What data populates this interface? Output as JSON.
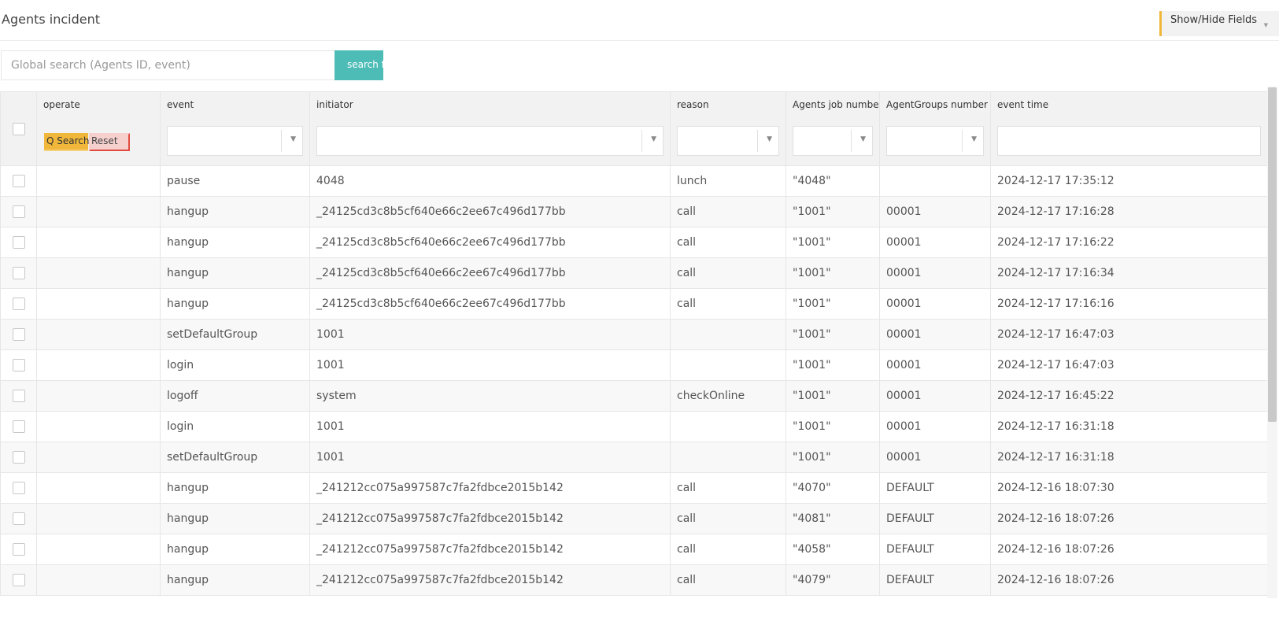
{
  "header": {
    "title": "Agents incident",
    "show_hide_label": "Show/Hide Fields"
  },
  "search": {
    "placeholder": "Global search (Agents ID, event)",
    "button_label": "search fo"
  },
  "table": {
    "columns": {
      "operate": "operate",
      "event": "event",
      "initiator": "initiator",
      "reason": "reason",
      "agent_job": "Agents job number",
      "group": "AgentGroups number",
      "time": "event time"
    },
    "filter_buttons": {
      "search": "Q Search",
      "reset": "Reset"
    },
    "rows": [
      {
        "event": "pause",
        "initiator": "4048",
        "reason": "lunch",
        "agent_job": "\"4048\"",
        "group": "",
        "time": "2024-12-17 17:35:12"
      },
      {
        "event": "hangup",
        "initiator": "_24125cd3c8b5cf640e66c2ee67c496d177bb",
        "reason": "call",
        "agent_job": "\"1001\"",
        "group": "00001",
        "time": "2024-12-17 17:16:28"
      },
      {
        "event": "hangup",
        "initiator": "_24125cd3c8b5cf640e66c2ee67c496d177bb",
        "reason": "call",
        "agent_job": "\"1001\"",
        "group": "00001",
        "time": "2024-12-17 17:16:22"
      },
      {
        "event": "hangup",
        "initiator": "_24125cd3c8b5cf640e66c2ee67c496d177bb",
        "reason": "call",
        "agent_job": "\"1001\"",
        "group": "00001",
        "time": "2024-12-17 17:16:34"
      },
      {
        "event": "hangup",
        "initiator": "_24125cd3c8b5cf640e66c2ee67c496d177bb",
        "reason": "call",
        "agent_job": "\"1001\"",
        "group": "00001",
        "time": "2024-12-17 17:16:16"
      },
      {
        "event": "setDefaultGroup",
        "initiator": "1001",
        "reason": "",
        "agent_job": "\"1001\"",
        "group": "00001",
        "time": "2024-12-17 16:47:03"
      },
      {
        "event": "login",
        "initiator": "1001",
        "reason": "",
        "agent_job": "\"1001\"",
        "group": "00001",
        "time": "2024-12-17 16:47:03"
      },
      {
        "event": "logoff",
        "initiator": "system",
        "reason": "checkOnline",
        "agent_job": "\"1001\"",
        "group": "00001",
        "time": "2024-12-17 16:45:22"
      },
      {
        "event": "login",
        "initiator": "1001",
        "reason": "",
        "agent_job": "\"1001\"",
        "group": "00001",
        "time": "2024-12-17 16:31:18"
      },
      {
        "event": "setDefaultGroup",
        "initiator": "1001",
        "reason": "",
        "agent_job": "\"1001\"",
        "group": "00001",
        "time": "2024-12-17 16:31:18"
      },
      {
        "event": "hangup",
        "initiator": "_241212cc075a997587c7fa2fdbce2015b142",
        "reason": "call",
        "agent_job": "\"4070\"",
        "group": "DEFAULT",
        "time": "2024-12-16 18:07:30"
      },
      {
        "event": "hangup",
        "initiator": "_241212cc075a997587c7fa2fdbce2015b142",
        "reason": "call",
        "agent_job": "\"4081\"",
        "group": "DEFAULT",
        "time": "2024-12-16 18:07:26"
      },
      {
        "event": "hangup",
        "initiator": "_241212cc075a997587c7fa2fdbce2015b142",
        "reason": "call",
        "agent_job": "\"4058\"",
        "group": "DEFAULT",
        "time": "2024-12-16 18:07:26"
      },
      {
        "event": "hangup",
        "initiator": "_241212cc075a997587c7fa2fdbce2015b142",
        "reason": "call",
        "agent_job": "\"4079\"",
        "group": "DEFAULT",
        "time": "2024-12-16 18:07:26"
      }
    ]
  },
  "colors": {
    "accent_yellow": "#f0b73a",
    "search_teal": "#4dbcb6",
    "reset_red": "#e14b3f"
  }
}
